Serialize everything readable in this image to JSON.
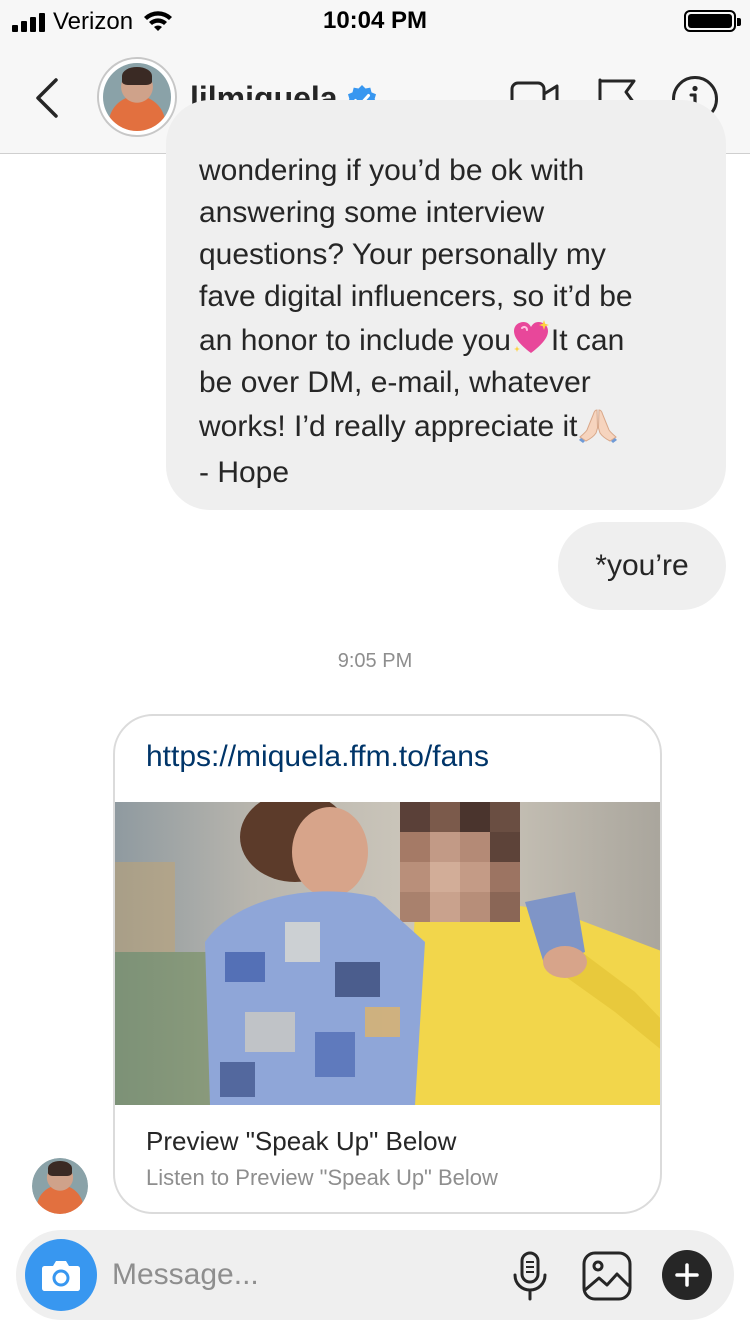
{
  "status_bar": {
    "carrier": "Verizon",
    "time": "10:04 PM"
  },
  "header": {
    "username": "lilmiquela",
    "verified": true,
    "icons": [
      "chevron-left-icon",
      "video-camera-icon",
      "flag-icon",
      "info-icon"
    ]
  },
  "messages": {
    "outgoing_long": {
      "lines": [
        "wondering if you’d be ok with",
        "answering some interview",
        "questions? Your personally my",
        "fave digital influencers, so it’d be",
        "an honor to include you",
        "It can",
        "be over DM, e-mail, whatever",
        "works! I’d really appreciate it",
        "- Hope"
      ],
      "emojis": [
        "sparkling-heart-emoji",
        "folded-hands-emoji"
      ]
    },
    "outgoing_short": "*you’re",
    "timestamp": "9:05 PM",
    "link_card": {
      "url": "https://miquela.ffm.to/fans",
      "title": "Preview \"Speak Up\" Below",
      "subtitle": "Listen to Preview \"Speak Up\" Below"
    }
  },
  "composer": {
    "placeholder": "Message...",
    "icons": [
      "camera-icon",
      "microphone-icon",
      "gallery-icon",
      "plus-icon"
    ]
  },
  "colors": {
    "accent_blue": "#3897f0",
    "link_color": "#003569",
    "bubble_gray": "#efefef",
    "verified_blue": "#3897f0"
  }
}
